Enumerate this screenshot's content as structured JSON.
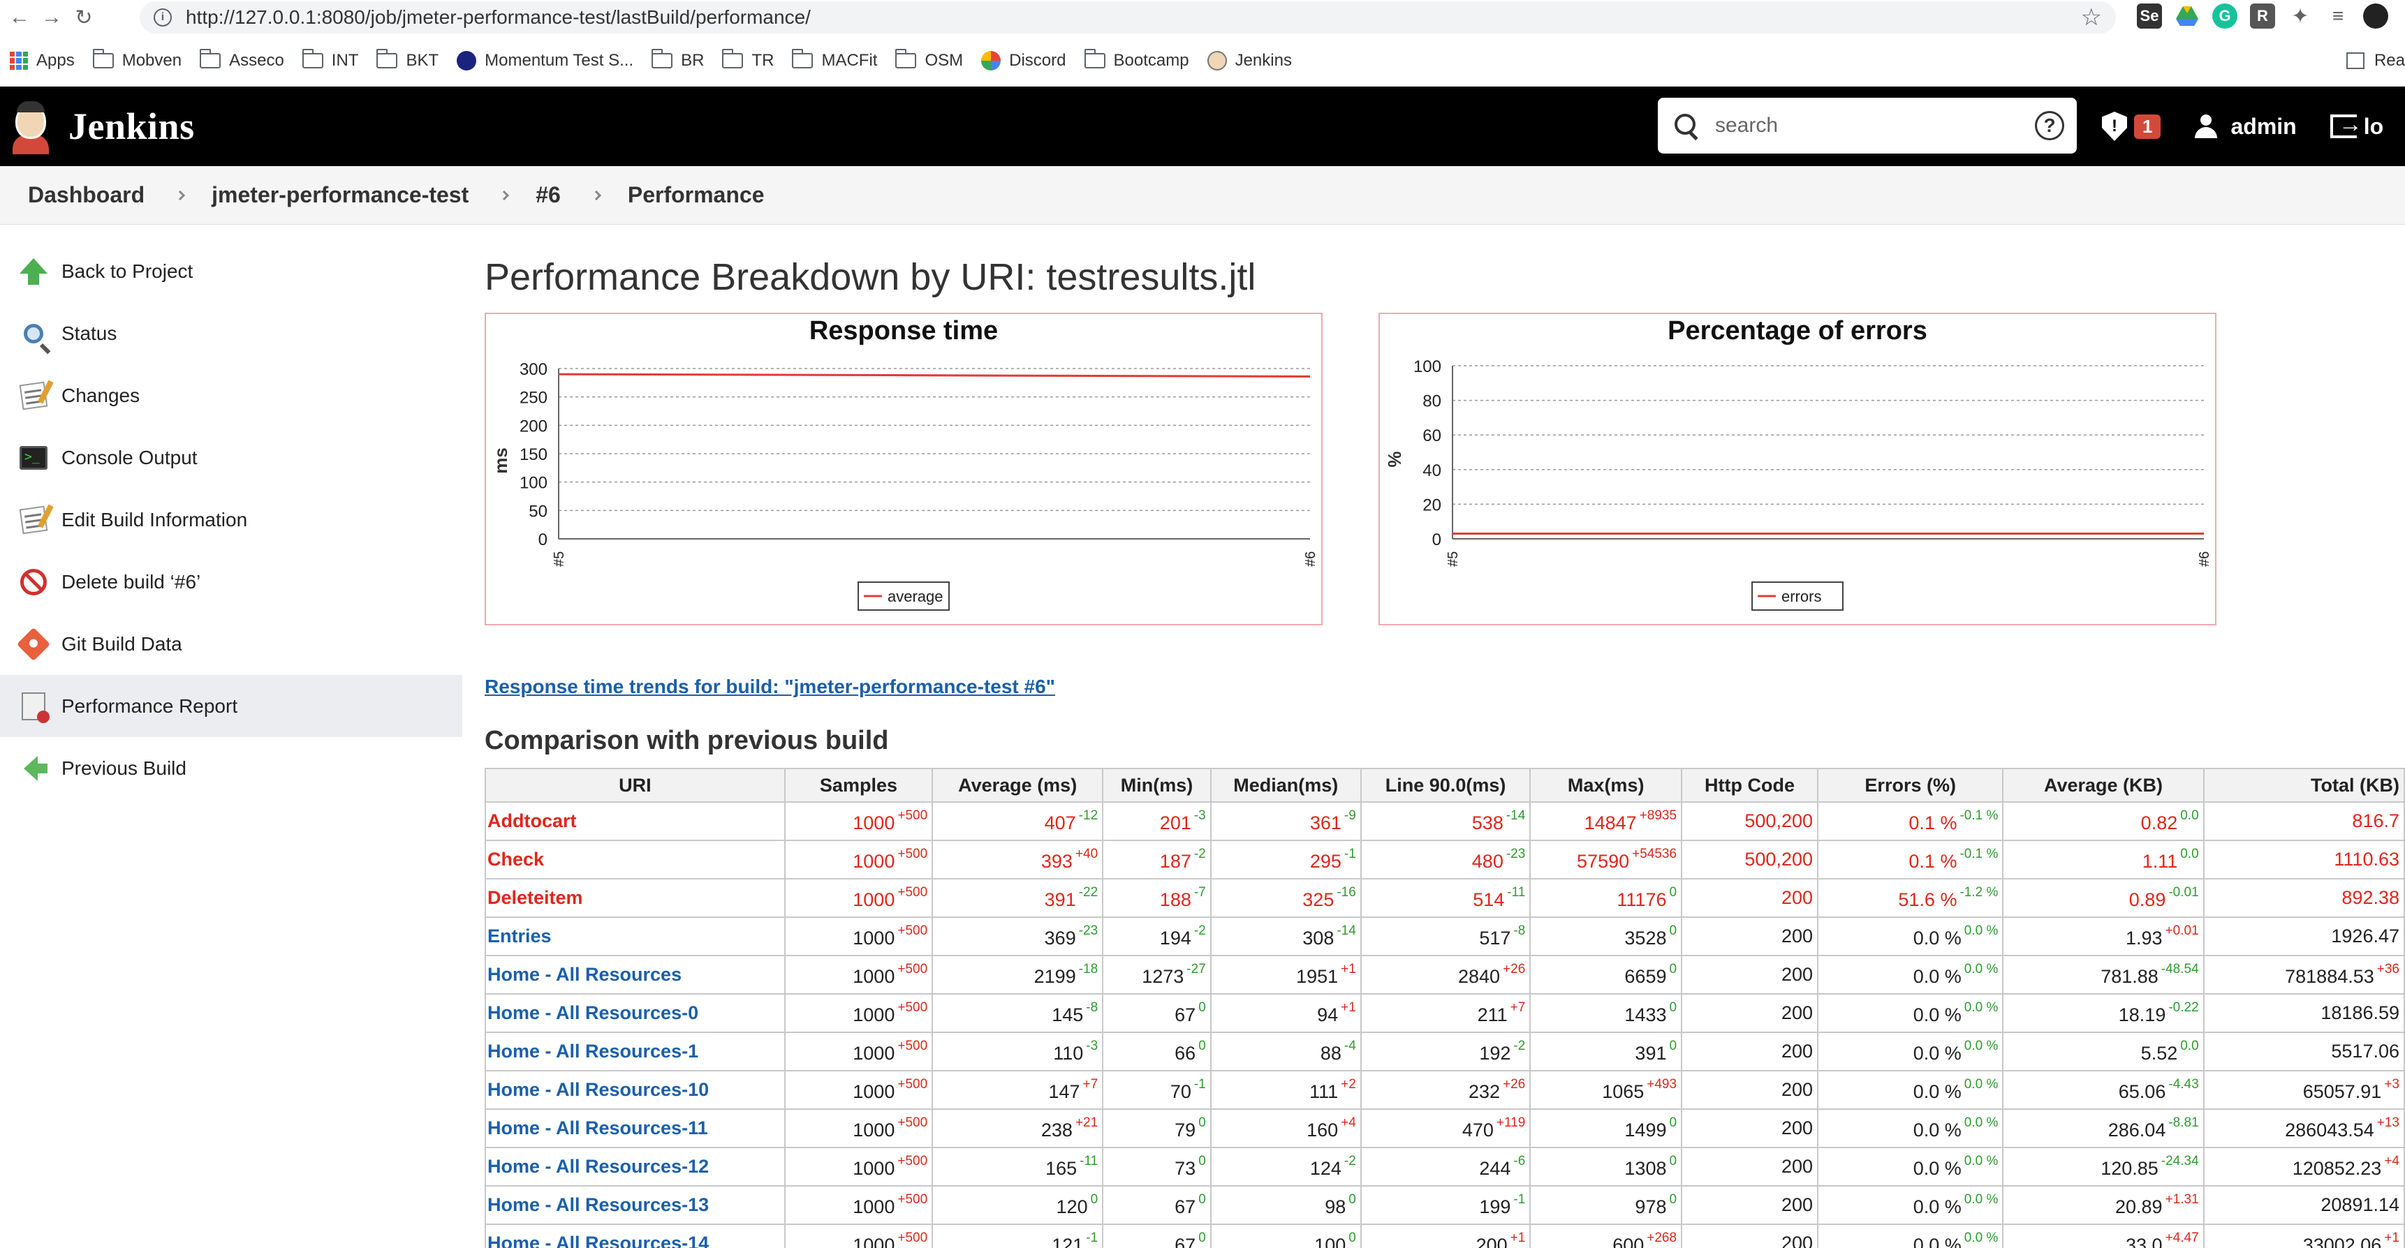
{
  "browser": {
    "url": "http://127.0.0.1:8080/job/jmeter-performance-test/lastBuild/performance/",
    "bookmarks": [
      "Apps",
      "Mobven",
      "Asseco",
      "INT",
      "BKT",
      "Momentum Test S...",
      "BR",
      "TR",
      "MACFit",
      "OSM",
      "Discord",
      "Bootcamp",
      "Jenkins"
    ],
    "reading_list": "Rea"
  },
  "header": {
    "title": "Jenkins",
    "search_placeholder": "search",
    "security_badge": "1",
    "user": "admin",
    "logout": "lo"
  },
  "breadcrumb": [
    "Dashboard",
    "jmeter-performance-test",
    "#6",
    "Performance"
  ],
  "sidebar": {
    "items": [
      {
        "label": "Back to Project",
        "icon": "back-arrow-up-icon"
      },
      {
        "label": "Status",
        "icon": "magnifier-icon"
      },
      {
        "label": "Changes",
        "icon": "notepad-icon"
      },
      {
        "label": "Console Output",
        "icon": "terminal-icon"
      },
      {
        "label": "Edit Build Information",
        "icon": "notepad-edit-icon"
      },
      {
        "label": "Delete build ‘#6’",
        "icon": "no-entry-icon"
      },
      {
        "label": "Git Build Data",
        "icon": "git-icon"
      },
      {
        "label": "Performance Report",
        "icon": "report-icon"
      },
      {
        "label": "Previous Build",
        "icon": "back-arrow-left-icon"
      }
    ],
    "active_index": 7
  },
  "main": {
    "title": "Performance Breakdown by URI: testresults.jtl",
    "trend_link": "Response time trends for build: \"jmeter-performance-test #6\"",
    "comparison_title": "Comparison with previous build"
  },
  "colors": {
    "error_red": "#e0261b",
    "link_blue": "#1b5faa",
    "delta_green": "#2e9b30",
    "chart_border": "#f0a8b0"
  },
  "chart_data": [
    {
      "type": "line",
      "title": "Response time",
      "ylabel": "ms",
      "xlabel": "",
      "categories": [
        "#5",
        "#6"
      ],
      "series": [
        {
          "name": "average",
          "values": [
            290,
            286
          ]
        }
      ],
      "ylim": [
        0,
        300
      ],
      "yticks": [
        0,
        50,
        100,
        150,
        200,
        250,
        300
      ],
      "grid": true,
      "legend": "bottom"
    },
    {
      "type": "line",
      "title": "Percentage of errors",
      "ylabel": "%",
      "xlabel": "",
      "categories": [
        "#5",
        "#6"
      ],
      "series": [
        {
          "name": "errors",
          "values": [
            3,
            3
          ]
        }
      ],
      "ylim": [
        0,
        100
      ],
      "yticks": [
        0,
        20,
        40,
        60,
        80,
        100
      ],
      "grid": true,
      "legend": "bottom"
    }
  ],
  "table": {
    "columns": [
      "URI",
      "Samples",
      "Average (ms)",
      "Min(ms)",
      "Median(ms)",
      "Line 90.0(ms)",
      "Max(ms)",
      "Http Code",
      "Errors (%)",
      "Average (KB)",
      "Total (KB)"
    ],
    "rows": [
      {
        "uri": "Addtocart",
        "error": true,
        "samples": [
          "1000",
          "+500"
        ],
        "avg": [
          "407",
          "-12"
        ],
        "min": [
          "201",
          "-3"
        ],
        "median": [
          "361",
          "-9"
        ],
        "line90": [
          "538",
          "-14"
        ],
        "max": [
          "14847",
          "+8935"
        ],
        "http": "500,200",
        "errors": [
          "0.1 %",
          "-0.1 %"
        ],
        "avgkb": [
          "0.82",
          "0.0"
        ],
        "total": [
          "816.7",
          ""
        ]
      },
      {
        "uri": "Check",
        "error": true,
        "samples": [
          "1000",
          "+500"
        ],
        "avg": [
          "393",
          "+40"
        ],
        "min": [
          "187",
          "-2"
        ],
        "median": [
          "295",
          "-1"
        ],
        "line90": [
          "480",
          "-23"
        ],
        "max": [
          "57590",
          "+54536"
        ],
        "http": "500,200",
        "errors": [
          "0.1 %",
          "-0.1 %"
        ],
        "avgkb": [
          "1.11",
          "0.0"
        ],
        "total": [
          "1110.63",
          ""
        ]
      },
      {
        "uri": "Deleteitem",
        "error": true,
        "samples": [
          "1000",
          "+500"
        ],
        "avg": [
          "391",
          "-22"
        ],
        "min": [
          "188",
          "-7"
        ],
        "median": [
          "325",
          "-16"
        ],
        "line90": [
          "514",
          "-11"
        ],
        "max": [
          "11176",
          "0"
        ],
        "http": "200",
        "errors": [
          "51.6 %",
          "-1.2 %"
        ],
        "avgkb": [
          "0.89",
          "-0.01"
        ],
        "total": [
          "892.38",
          ""
        ]
      },
      {
        "uri": "Entries",
        "error": false,
        "samples": [
          "1000",
          "+500"
        ],
        "avg": [
          "369",
          "-23"
        ],
        "min": [
          "194",
          "-2"
        ],
        "median": [
          "308",
          "-14"
        ],
        "line90": [
          "517",
          "-8"
        ],
        "max": [
          "3528",
          "0"
        ],
        "http": "200",
        "errors": [
          "0.0 %",
          "0.0 %"
        ],
        "avgkb": [
          "1.93",
          "+0.01"
        ],
        "total": [
          "1926.47",
          ""
        ]
      },
      {
        "uri": "Home - All Resources",
        "error": false,
        "samples": [
          "1000",
          "+500"
        ],
        "avg": [
          "2199",
          "-18"
        ],
        "min": [
          "1273",
          "-27"
        ],
        "median": [
          "1951",
          "+1"
        ],
        "line90": [
          "2840",
          "+26"
        ],
        "max": [
          "6659",
          "0"
        ],
        "http": "200",
        "errors": [
          "0.0 %",
          "0.0 %"
        ],
        "avgkb": [
          "781.88",
          "-48.54"
        ],
        "total": [
          "781884.53",
          "+36"
        ]
      },
      {
        "uri": "Home - All Resources-0",
        "error": false,
        "samples": [
          "1000",
          "+500"
        ],
        "avg": [
          "145",
          "-8"
        ],
        "min": [
          "67",
          "0"
        ],
        "median": [
          "94",
          "+1"
        ],
        "line90": [
          "211",
          "+7"
        ],
        "max": [
          "1433",
          "0"
        ],
        "http": "200",
        "errors": [
          "0.0 %",
          "0.0 %"
        ],
        "avgkb": [
          "18.19",
          "-0.22"
        ],
        "total": [
          "18186.59",
          ""
        ]
      },
      {
        "uri": "Home - All Resources-1",
        "error": false,
        "samples": [
          "1000",
          "+500"
        ],
        "avg": [
          "110",
          "-3"
        ],
        "min": [
          "66",
          "0"
        ],
        "median": [
          "88",
          "-4"
        ],
        "line90": [
          "192",
          "-2"
        ],
        "max": [
          "391",
          "0"
        ],
        "http": "200",
        "errors": [
          "0.0 %",
          "0.0 %"
        ],
        "avgkb": [
          "5.52",
          "0.0"
        ],
        "total": [
          "5517.06",
          ""
        ]
      },
      {
        "uri": "Home - All Resources-10",
        "error": false,
        "samples": [
          "1000",
          "+500"
        ],
        "avg": [
          "147",
          "+7"
        ],
        "min": [
          "70",
          "-1"
        ],
        "median": [
          "111",
          "+2"
        ],
        "line90": [
          "232",
          "+26"
        ],
        "max": [
          "1065",
          "+493"
        ],
        "http": "200",
        "errors": [
          "0.0 %",
          "0.0 %"
        ],
        "avgkb": [
          "65.06",
          "-4.43"
        ],
        "total": [
          "65057.91",
          "+3"
        ]
      },
      {
        "uri": "Home - All Resources-11",
        "error": false,
        "samples": [
          "1000",
          "+500"
        ],
        "avg": [
          "238",
          "+21"
        ],
        "min": [
          "79",
          "0"
        ],
        "median": [
          "160",
          "+4"
        ],
        "line90": [
          "470",
          "+119"
        ],
        "max": [
          "1499",
          "0"
        ],
        "http": "200",
        "errors": [
          "0.0 %",
          "0.0 %"
        ],
        "avgkb": [
          "286.04",
          "-8.81"
        ],
        "total": [
          "286043.54",
          "+13"
        ]
      },
      {
        "uri": "Home - All Resources-12",
        "error": false,
        "samples": [
          "1000",
          "+500"
        ],
        "avg": [
          "165",
          "-11"
        ],
        "min": [
          "73",
          "0"
        ],
        "median": [
          "124",
          "-2"
        ],
        "line90": [
          "244",
          "-6"
        ],
        "max": [
          "1308",
          "0"
        ],
        "http": "200",
        "errors": [
          "0.0 %",
          "0.0 %"
        ],
        "avgkb": [
          "120.85",
          "-24.34"
        ],
        "total": [
          "120852.23",
          "+4"
        ]
      },
      {
        "uri": "Home - All Resources-13",
        "error": false,
        "samples": [
          "1000",
          "+500"
        ],
        "avg": [
          "120",
          "0"
        ],
        "min": [
          "67",
          "0"
        ],
        "median": [
          "98",
          "0"
        ],
        "line90": [
          "199",
          "-1"
        ],
        "max": [
          "978",
          "0"
        ],
        "http": "200",
        "errors": [
          "0.0 %",
          "0.0 %"
        ],
        "avgkb": [
          "20.89",
          "+1.31"
        ],
        "total": [
          "20891.14",
          ""
        ]
      },
      {
        "uri": "Home - All Resources-14",
        "error": false,
        "samples": [
          "1000",
          "+500"
        ],
        "avg": [
          "121",
          "-1"
        ],
        "min": [
          "67",
          "0"
        ],
        "median": [
          "100",
          "0"
        ],
        "line90": [
          "200",
          "+1"
        ],
        "max": [
          "600",
          "+268"
        ],
        "http": "200",
        "errors": [
          "0.0 %",
          "0.0 %"
        ],
        "avgkb": [
          "33.0",
          "+4.47"
        ],
        "total": [
          "33002.06",
          "+1"
        ]
      }
    ]
  }
}
